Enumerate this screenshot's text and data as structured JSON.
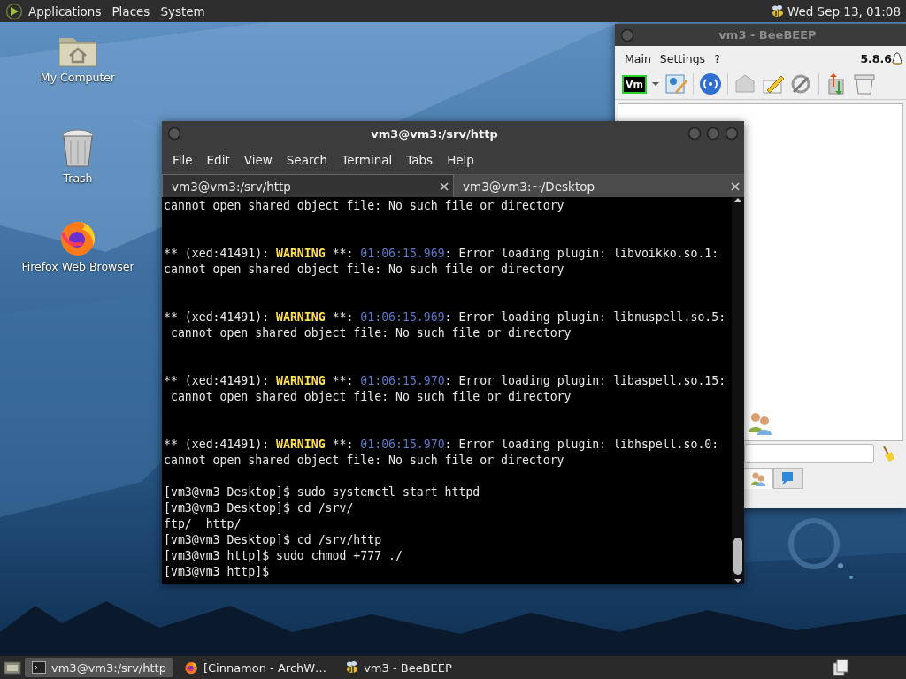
{
  "top_panel": {
    "menus": [
      "Applications",
      "Places",
      "System"
    ],
    "clock": "Wed Sep 13, 01:08"
  },
  "desktop_icons": [
    {
      "kind": "computer",
      "label": "My Computer"
    },
    {
      "kind": "trash",
      "label": "Trash"
    },
    {
      "kind": "browser",
      "label": "Firefox Web Browser"
    }
  ],
  "beebeep": {
    "title": "vm3 - BeeBEEP",
    "menus": [
      "Main",
      "Settings",
      "?"
    ],
    "version": "5.8.6",
    "account_badge": "Vm",
    "tabs": [
      {
        "kind": "users",
        "selected": true
      },
      {
        "kind": "chat",
        "selected": false
      }
    ]
  },
  "terminal": {
    "title": "vm3@vm3:/srv/http",
    "menus": [
      "File",
      "Edit",
      "View",
      "Search",
      "Terminal",
      "Tabs",
      "Help"
    ],
    "tabs": [
      {
        "label": "vm3@vm3:/srv/http",
        "selected": true
      },
      {
        "label": "vm3@vm3:~/Desktop",
        "selected": false
      }
    ],
    "lines": [
      {
        "kind": "text",
        "text": "cannot open shared object file: No such file or directory"
      },
      {
        "kind": "blank"
      },
      {
        "kind": "blank"
      },
      {
        "kind": "warning",
        "source": "** (xed:41491):",
        "level_word": "WARNING",
        "marker": "**:",
        "time": "01:06:15.969",
        "message": ": Error loading plugin: libvoikko.so.1:"
      },
      {
        "kind": "text",
        "text": "cannot open shared object file: No such file or directory"
      },
      {
        "kind": "blank"
      },
      {
        "kind": "blank"
      },
      {
        "kind": "warning",
        "source": "** (xed:41491):",
        "level_word": "WARNING",
        "marker": "**:",
        "time": "01:06:15.969",
        "message": ": Error loading plugin: libnuspell.so.5:"
      },
      {
        "kind": "text",
        "text": " cannot open shared object file: No such file or directory"
      },
      {
        "kind": "blank"
      },
      {
        "kind": "blank"
      },
      {
        "kind": "warning",
        "source": "** (xed:41491):",
        "level_word": "WARNING",
        "marker": "**:",
        "time": "01:06:15.970",
        "message": ": Error loading plugin: libaspell.so.15:"
      },
      {
        "kind": "text",
        "text": " cannot open shared object file: No such file or directory"
      },
      {
        "kind": "blank"
      },
      {
        "kind": "blank"
      },
      {
        "kind": "warning",
        "source": "** (xed:41491):",
        "level_word": "WARNING",
        "marker": "**:",
        "time": "01:06:15.970",
        "message": ": Error loading plugin: libhspell.so.0:"
      },
      {
        "kind": "text",
        "text": "cannot open shared object file: No such file or directory"
      },
      {
        "kind": "blank"
      },
      {
        "kind": "text",
        "text": "[vm3@vm3 Desktop]$ sudo systemctl start httpd"
      },
      {
        "kind": "text",
        "text": "[vm3@vm3 Desktop]$ cd /srv/"
      },
      {
        "kind": "text",
        "text": "ftp/  http/"
      },
      {
        "kind": "text",
        "text": "[vm3@vm3 Desktop]$ cd /srv/http"
      },
      {
        "kind": "text",
        "text": "[vm3@vm3 http]$ sudo chmod +777 ./"
      },
      {
        "kind": "text",
        "text": "[vm3@vm3 http]$"
      }
    ]
  },
  "taskbar": {
    "items": [
      {
        "kind": "terminal",
        "label": "vm3@vm3:/srv/http",
        "selected": true
      },
      {
        "kind": "browser",
        "label": "[Cinnamon - ArchW…",
        "selected": false
      },
      {
        "kind": "bee",
        "label": "vm3 - BeeBEEP",
        "selected": false
      }
    ]
  }
}
